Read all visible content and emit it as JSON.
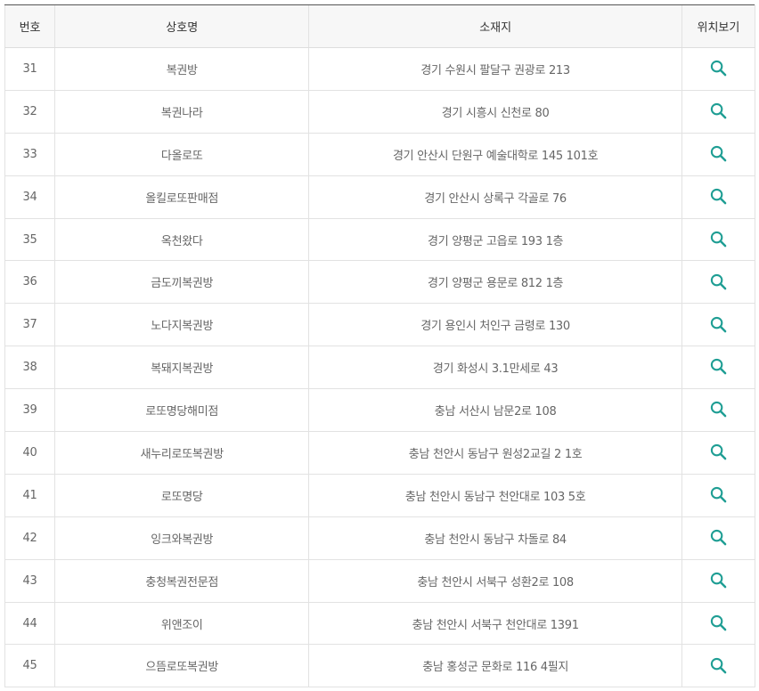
{
  "colors": {
    "accent": "#1f9e94",
    "header_bg": "#f7f7f7"
  },
  "table": {
    "headers": {
      "no": "번호",
      "name": "상호명",
      "address": "소재지",
      "location": "위치보기"
    },
    "location_icon": "search-icon",
    "rows": [
      {
        "no": "31",
        "name": "복권방",
        "address": "경기 수원시 팔달구 권광로 213"
      },
      {
        "no": "32",
        "name": "복권나라",
        "address": "경기 시흥시 신천로 80"
      },
      {
        "no": "33",
        "name": "다올로또",
        "address": "경기 안산시 단원구 예술대학로 145 101호"
      },
      {
        "no": "34",
        "name": "올킬로또판매점",
        "address": "경기 안산시 상록구 각골로 76"
      },
      {
        "no": "35",
        "name": "옥천왔다",
        "address": "경기 양평군 고읍로 193 1층"
      },
      {
        "no": "36",
        "name": "금도끼복권방",
        "address": "경기 양평군 용문로 812 1층"
      },
      {
        "no": "37",
        "name": "노다지복권방",
        "address": "경기 용인시 처인구 금령로 130"
      },
      {
        "no": "38",
        "name": "복돼지복권방",
        "address": "경기 화성시 3.1만세로 43"
      },
      {
        "no": "39",
        "name": "로또명당해미점",
        "address": "충남 서산시 남문2로 108"
      },
      {
        "no": "40",
        "name": "새누리로또복권방",
        "address": "충남 천안시 동남구 원성2교길 2 1호"
      },
      {
        "no": "41",
        "name": "로또명당",
        "address": "충남 천안시 동남구 천안대로 103 5호"
      },
      {
        "no": "42",
        "name": "잉크와복권방",
        "address": "충남 천안시 동남구 차돌로 84"
      },
      {
        "no": "43",
        "name": "충청복권전문점",
        "address": "충남 천안시 서북구 성환2로 108"
      },
      {
        "no": "44",
        "name": "위앤조이",
        "address": "충남 천안시 서북구 천안대로 1391"
      },
      {
        "no": "45",
        "name": "으뜸로또복권방",
        "address": "충남 홍성군 문화로 116 4필지"
      }
    ]
  }
}
